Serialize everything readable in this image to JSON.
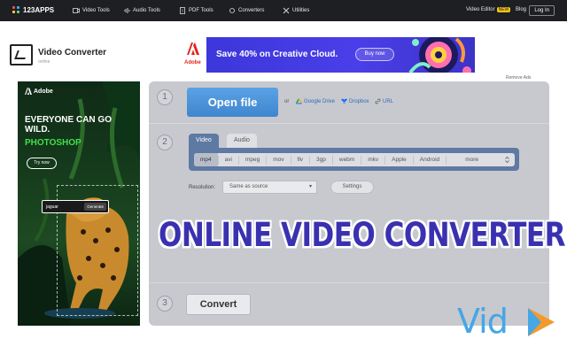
{
  "nav": {
    "logo": "123APPS",
    "items": [
      "Video Tools",
      "Audio Tools",
      "PDF Tools",
      "Converters",
      "Utilities"
    ],
    "video_editor": "Video Editor",
    "new_badge": "NEW",
    "blog": "Blog",
    "login": "Log In"
  },
  "header": {
    "title": "Video Converter",
    "subtitle": "online"
  },
  "banner_ad": {
    "brand": "Adobe",
    "text": "Save 40% on Creative Cloud.",
    "button": "Buy now"
  },
  "remove_ads": "Remove Ads",
  "side_ad": {
    "brand": "Adobe",
    "headline": "EVERYONE CAN GO WILD.",
    "product": "PHOTOSHOP",
    "button": "Try now",
    "input_value": "jaguar",
    "generate": "Generate"
  },
  "step1": {
    "number": "1",
    "open_file": "Open file",
    "or": "or",
    "google_drive": "Google Drive",
    "dropbox": "Dropbox",
    "url": "URL"
  },
  "step2": {
    "number": "2",
    "tab_video": "Video",
    "tab_audio": "Audio",
    "formats": [
      "mp4",
      "avi",
      "mpeg",
      "mov",
      "flv",
      "3gp",
      "webm",
      "mkv",
      "Apple",
      "Android"
    ],
    "more": "more",
    "resolution_label": "Resolution:",
    "resolution_value": "Same as source",
    "settings": "Settings"
  },
  "step3": {
    "number": "3",
    "convert": "Convert"
  },
  "overlay_headline": "ONLINE VIDEO CONVERTER",
  "watermark": "Vid",
  "colors": {
    "nav_bg": "#1e1f23",
    "open_button": "#4a93da",
    "format_bar": "#5e79a2",
    "headline": "#3a31b0",
    "watermark": "#45a7e5",
    "side_accent": "#3fe04a"
  }
}
